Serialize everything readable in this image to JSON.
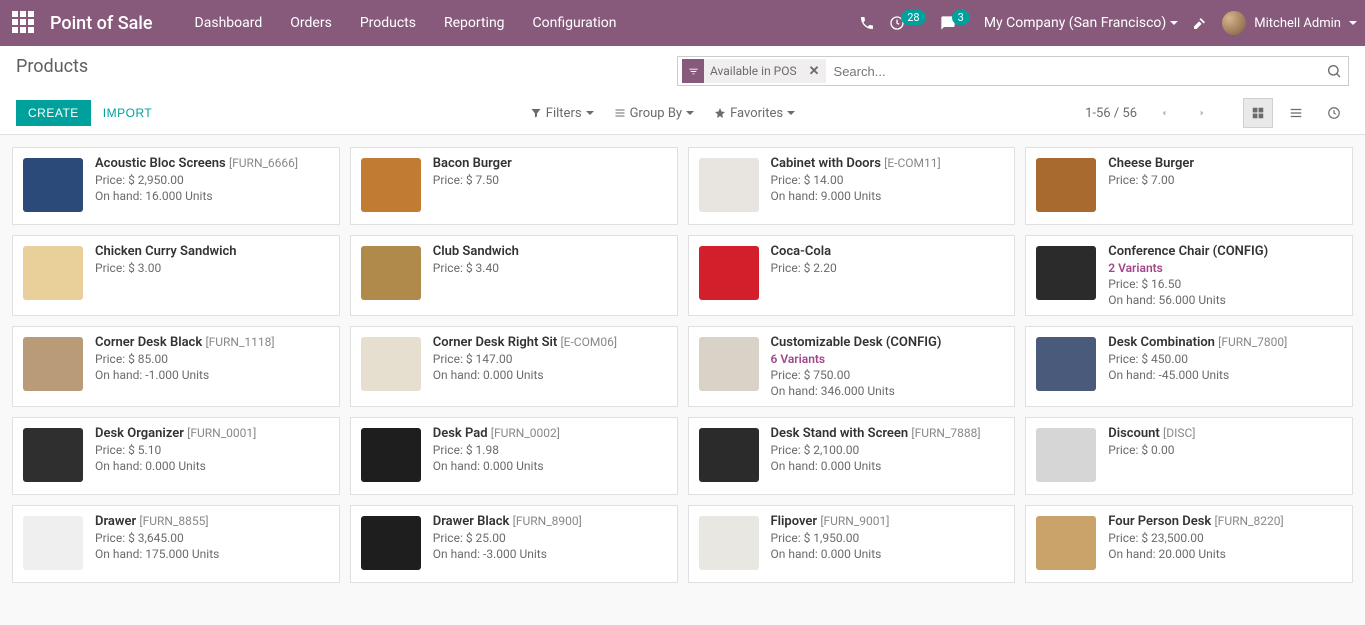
{
  "topbar": {
    "brand": "Point of Sale",
    "nav": [
      "Dashboard",
      "Orders",
      "Products",
      "Reporting",
      "Configuration"
    ],
    "activity_count": "28",
    "message_count": "3",
    "company": "My Company (San Francisco)",
    "user": "Mitchell Admin"
  },
  "controls": {
    "page_title": "Products",
    "create": "CREATE",
    "import": "IMPORT",
    "filter_facet": "Available in POS",
    "search_placeholder": "Search...",
    "filters": "Filters",
    "groupby": "Group By",
    "favorites": "Favorites",
    "pager": "1-56 / 56"
  },
  "products": [
    {
      "name": "Acoustic Bloc Screens",
      "sku": "[FURN_6666]",
      "price": "Price: $ 2,950.00",
      "onhand": "On hand: 16.000 Units",
      "color": "#2b4a7a"
    },
    {
      "name": "Bacon Burger",
      "sku": "",
      "price": "Price: $ 7.50",
      "onhand": "",
      "color": "#c27b33"
    },
    {
      "name": "Cabinet with Doors",
      "sku": "[E-COM11]",
      "price": "Price: $ 14.00",
      "onhand": "On hand: 9.000 Units",
      "color": "#e8e5e0"
    },
    {
      "name": "Cheese Burger",
      "sku": "",
      "price": "Price: $ 7.00",
      "onhand": "",
      "color": "#a86a2e"
    },
    {
      "name": "Chicken Curry Sandwich",
      "sku": "",
      "price": "Price: $ 3.00",
      "onhand": "",
      "color": "#e9cf9a"
    },
    {
      "name": "Club Sandwich",
      "sku": "",
      "price": "Price: $ 3.40",
      "onhand": "",
      "color": "#b08a4a"
    },
    {
      "name": "Coca-Cola",
      "sku": "",
      "price": "Price: $ 2.20",
      "onhand": "",
      "color": "#d31f2b"
    },
    {
      "name": "Conference Chair (CONFIG)",
      "sku": "",
      "variants": "2 Variants",
      "price": "Price: $ 16.50",
      "onhand": "On hand: 56.000 Units",
      "color": "#2b2b2b"
    },
    {
      "name": "Corner Desk Black",
      "sku": "[FURN_1118]",
      "price": "Price: $ 85.00",
      "onhand": "On hand: -1.000 Units",
      "color": "#b99b77"
    },
    {
      "name": "Corner Desk Right Sit",
      "sku": "[E-COM06]",
      "price": "Price: $ 147.00",
      "onhand": "On hand: 0.000 Units",
      "color": "#e6dfcf"
    },
    {
      "name": "Customizable Desk (CONFIG)",
      "sku": "",
      "variants": "6 Variants",
      "price": "Price: $ 750.00",
      "onhand": "On hand: 346.000 Units",
      "color": "#d9d3c7"
    },
    {
      "name": "Desk Combination",
      "sku": "[FURN_7800]",
      "price": "Price: $ 450.00",
      "onhand": "On hand: -45.000 Units",
      "color": "#4a5a7a"
    },
    {
      "name": "Desk Organizer",
      "sku": "[FURN_0001]",
      "price": "Price: $ 5.10",
      "onhand": "On hand: 0.000 Units",
      "color": "#2f2f2f"
    },
    {
      "name": "Desk Pad",
      "sku": "[FURN_0002]",
      "price": "Price: $ 1.98",
      "onhand": "On hand: 0.000 Units",
      "color": "#1e1e1e"
    },
    {
      "name": "Desk Stand with Screen",
      "sku": "[FURN_7888]",
      "price": "Price: $ 2,100.00",
      "onhand": "On hand: 0.000 Units",
      "color": "#2b2b2b"
    },
    {
      "name": "Discount",
      "sku": "[DISC]",
      "price": "Price: $ 0.00",
      "onhand": "",
      "color": "#d6d6d6"
    },
    {
      "name": "Drawer",
      "sku": "[FURN_8855]",
      "price": "Price: $ 3,645.00",
      "onhand": "On hand: 175.000 Units",
      "color": "#f0efef"
    },
    {
      "name": "Drawer Black",
      "sku": "[FURN_8900]",
      "price": "Price: $ 25.00",
      "onhand": "On hand: -3.000 Units",
      "color": "#1e1e1e"
    },
    {
      "name": "Flipover",
      "sku": "[FURN_9001]",
      "price": "Price: $ 1,950.00",
      "onhand": "On hand: 0.000 Units",
      "color": "#e9e7e2"
    },
    {
      "name": "Four Person Desk",
      "sku": "[FURN_8220]",
      "price": "Price: $ 23,500.00",
      "onhand": "On hand: 20.000 Units",
      "color": "#c9a36a"
    }
  ]
}
